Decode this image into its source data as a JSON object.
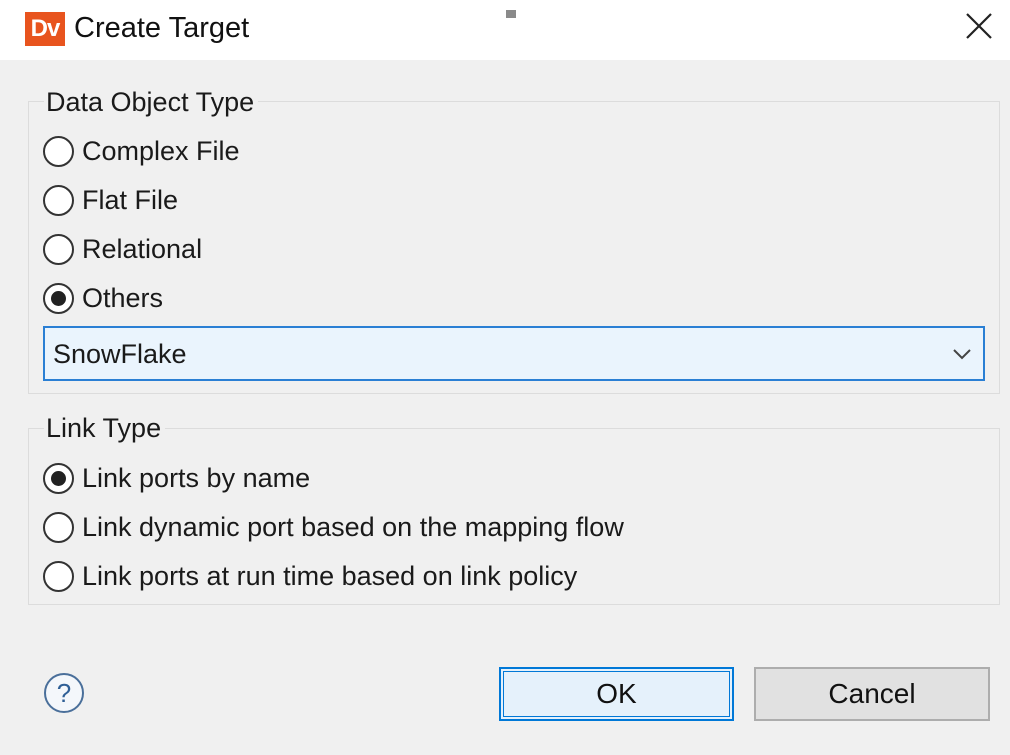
{
  "window": {
    "app_icon_text": "Dv",
    "title": "Create Target",
    "icons": {
      "close": "close-icon",
      "help": "help-icon",
      "dropdown": "chevron-down-icon"
    }
  },
  "data_object_type": {
    "legend": "Data Object Type",
    "options": [
      {
        "label": "Complex File",
        "checked": false
      },
      {
        "label": "Flat File",
        "checked": false
      },
      {
        "label": "Relational",
        "checked": false
      },
      {
        "label": "Others",
        "checked": true
      }
    ],
    "others_select": {
      "value": "SnowFlake"
    }
  },
  "link_type": {
    "legend": "Link Type",
    "options": [
      {
        "label": "Link ports by name",
        "checked": true
      },
      {
        "label": "Link dynamic port based on the mapping flow",
        "checked": false
      },
      {
        "label": "Link ports at run time based on link policy",
        "checked": false
      }
    ]
  },
  "buttons": {
    "ok": "OK",
    "cancel": "Cancel"
  },
  "colors": {
    "accent": "#0078d7",
    "app_icon_bg": "#e8541e",
    "select_bg": "#eaf4fd"
  }
}
